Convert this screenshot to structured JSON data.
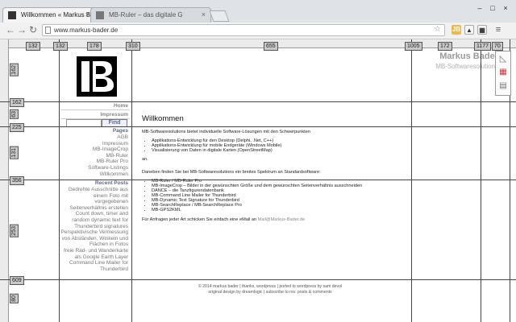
{
  "browser": {
    "tabs": [
      {
        "title": "Willkommen « Markus Ba"
      },
      {
        "title": "MB-Ruler – das digitale G"
      }
    ],
    "url": "www.markus-bader.de"
  },
  "ruler": {
    "h_labels": [
      "132",
      "132",
      "178",
      "310",
      "655",
      "1005",
      "172",
      "1177",
      "70"
    ],
    "v_labels": [
      "162",
      "162",
      "63",
      "225",
      "131",
      "356",
      "253",
      "609",
      "80"
    ]
  },
  "site": {
    "logo_title": "Markus Bader",
    "logo_subtitle": "MB-Softwaresolutions"
  },
  "sidebar": {
    "top_links": [
      "Home",
      "Impressum"
    ],
    "search_button": "Find",
    "pages_heading": "Pages",
    "pages": [
      "AGB",
      "Impressum",
      "MB-ImageCrop",
      "MB-Ruler",
      "MB-Ruler Pro",
      "Software-Listings",
      "Willkommen"
    ],
    "recent_heading": "Recent Posts",
    "recent": [
      "Gedrehte Ausschnitte aus einem Foto mit vorgegebenen Seitenverhältnis erstellen",
      "Count down, timer and random dynamic text for Thunderbird signatures",
      "Perspektivische Vermessung von Abständen, Winkeln und Flächen in Fotos",
      "freie Rad- und Wanderkarte als Google Earth Layer",
      "Command Line Mailer for Thunderbird"
    ]
  },
  "content": {
    "title": "Willkommen",
    "intro": "MB-Softwaresolutions bietet individuelle Software-Lösungen mit den Schwerpunkten",
    "bullets1": [
      "Applikations-Entwicklung für den Desktop (Delphi, .Net, C++)",
      "Applikations-Entwicklung für mobile Endgeräte (Windows Mobile)",
      "Visualisierung von Daten in digitale Karten (OpenStreetMap)"
    ],
    "an": "an.",
    "para2": "Daneben finden Sie bei MB-Softwaresolutions ein breites Spektrum an Standardsoftware:",
    "bullets2": [
      "MB-Ruler / MB-Ruler Pro",
      "MB-ImageCrop – Bilder in der gewünschten Größe und dem gewünschten Seitenverhältnis ausschneiden",
      "DANCE – die Tanzfigurendatenbank",
      "MB-Command Line Mailer for Thunderbird",
      "MB-Dynamic Text Signature for Thunderbird",
      "MB-SearchReplace / MB-SearchReplace Pro",
      "MB-GPS2KML"
    ],
    "contact_prefix": "Für Anfragen jeder Art schicken Sie einfach eine eMail an ",
    "contact_email": "Mail@Markus-Bader.de"
  },
  "footer": {
    "line1": "© 2014 markus bader | thanks, wordpress | ported to wordpress by sam devol",
    "line2": "original design by dreamlogic | subscribe to rss: posts & comments"
  },
  "colors": {
    "accent": "#5a6a8a",
    "muted_link": "#8b8b8b"
  }
}
